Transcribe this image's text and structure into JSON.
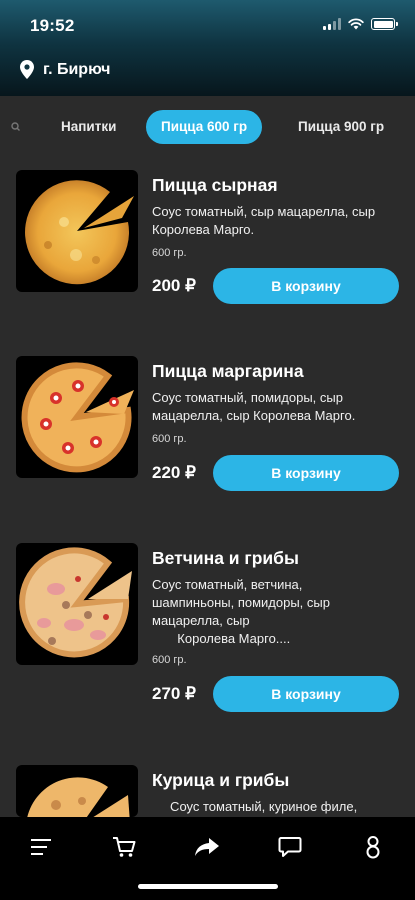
{
  "status_bar": {
    "time": "19:52"
  },
  "location": {
    "city": "г. Бирюч"
  },
  "categories": [
    {
      "label": "Напитки"
    },
    {
      "label": "Пицца 600 гр",
      "active": true
    },
    {
      "label": "Пицца 900 гр"
    }
  ],
  "products": [
    {
      "title": "Пицца сырная",
      "description": "     Соус томатный, сыр мацарелла, сыр Королева Марго.",
      "weight": "600 гр.",
      "price": "200 ₽",
      "button_label": "В корзину"
    },
    {
      "title": "Пицца маргарина",
      "description": "Соус томатный, помидоры, сыр мацарелла, сыр Королева Марго.",
      "weight": "600 гр.",
      "price": "220 ₽",
      "button_label": "В корзину"
    },
    {
      "title": "Ветчина и грибы",
      "description_lines": [
        "Соус томатный, ветчина,",
        "шампиньоны, помидоры, сыр",
        "мацарелла, сыр",
        "       Королева Марго...."
      ],
      "weight": "600 гр.",
      "price": "270 ₽",
      "button_label": "В корзину"
    },
    {
      "title": "Курица и грибы",
      "description": "     Соус томатный, куриное филе,"
    }
  ],
  "bottom_nav": {
    "items": [
      {
        "icon": "menu-icon"
      },
      {
        "icon": "cart-icon"
      },
      {
        "icon": "share-icon"
      },
      {
        "icon": "chat-icon"
      },
      {
        "icon": "profile-icon"
      }
    ]
  },
  "colors": {
    "accent": "#2cb5e6",
    "background": "#2b2b2b",
    "nav_background": "#000000"
  }
}
